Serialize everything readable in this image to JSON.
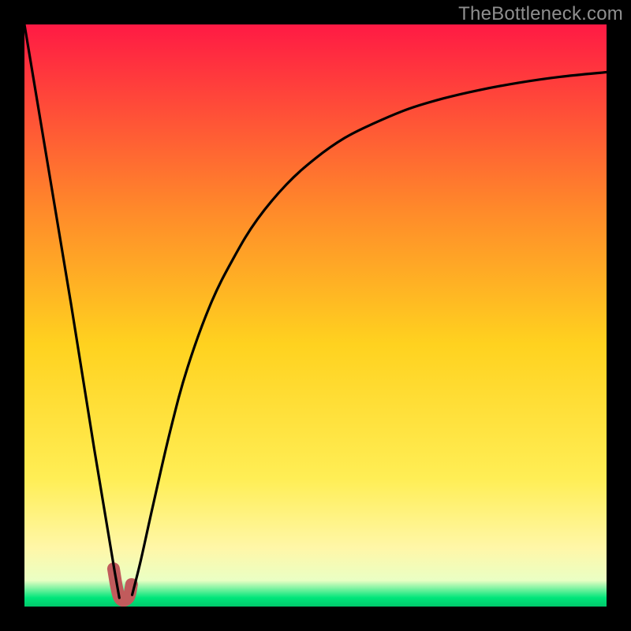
{
  "watermark": {
    "text": "TheBottleneck.com"
  },
  "colors": {
    "frame": "#000000",
    "accent_stroke": "#c15b5c",
    "curve_stroke": "#000000",
    "gradient_top": "#ff1a44",
    "gradient_mid_upper": "#ff8a2a",
    "gradient_mid": "#ffd21f",
    "gradient_mid_lower": "#ffee55",
    "gradient_soft_yellow": "#fff7a8",
    "gradient_pale": "#eaffc4",
    "gradient_green": "#00e57a",
    "gradient_bottom_line": "#00c96b"
  },
  "chart_data": {
    "type": "line",
    "title": "",
    "xlabel": "",
    "ylabel": "",
    "xlim": [
      0,
      100
    ],
    "ylim": [
      0,
      100
    ],
    "grid": false,
    "legend": false,
    "notes": "Axes unlabeled in source image; x and y are normalized 0–100 from the visible plot area. Higher y = higher on screen. Values estimated from pixels.",
    "series": [
      {
        "name": "left-descent",
        "kind": "line",
        "x": [
          0,
          4,
          8,
          12,
          14,
          15.5,
          16.3
        ],
        "y": [
          100,
          76,
          52,
          27,
          15,
          6,
          1.5
        ]
      },
      {
        "name": "right-ascent",
        "kind": "curve",
        "x": [
          18.5,
          20,
          22,
          25,
          28,
          32,
          36,
          40,
          45,
          50,
          55,
          60,
          66,
          72,
          78,
          85,
          92,
          100
        ],
        "y": [
          2,
          8,
          17,
          30,
          41,
          52,
          60,
          66.5,
          72.5,
          77,
          80.5,
          83,
          85.5,
          87.3,
          88.7,
          90,
          91,
          91.8
        ]
      },
      {
        "name": "accent-hook",
        "kind": "line",
        "color": "#c15b5c",
        "stroke_width_px": 16,
        "x": [
          15.3,
          16.3,
          17.8,
          18.4
        ],
        "y": [
          6.5,
          1.6,
          1.5,
          3.8
        ]
      }
    ],
    "background_gradient": {
      "orientation": "vertical",
      "stops": [
        {
          "pos": 0.0,
          "color": "#ff1a44"
        },
        {
          "pos": 0.32,
          "color": "#ff8a2a"
        },
        {
          "pos": 0.55,
          "color": "#ffd21f"
        },
        {
          "pos": 0.78,
          "color": "#ffee55"
        },
        {
          "pos": 0.9,
          "color": "#fff7a8"
        },
        {
          "pos": 0.955,
          "color": "#eaffc4"
        },
        {
          "pos": 0.985,
          "color": "#00e57a"
        },
        {
          "pos": 1.0,
          "color": "#00c96b"
        }
      ]
    }
  }
}
